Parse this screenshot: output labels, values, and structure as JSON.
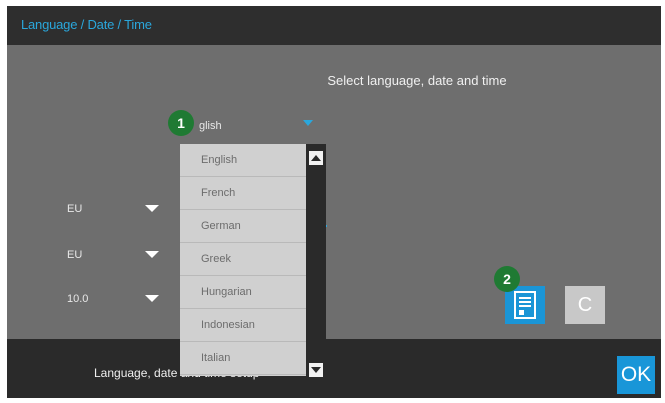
{
  "window": {
    "title": "Language / Date / Time"
  },
  "main": {
    "prompt": "Select language, date and time",
    "language_value": "glish",
    "settings": [
      {
        "value": "EU"
      },
      {
        "value": "EU"
      },
      {
        "value": "10.0"
      }
    ]
  },
  "language_dropdown": {
    "options": [
      "English",
      "French",
      "German",
      "Greek",
      "Hungarian",
      "Indonesian",
      "Italian"
    ]
  },
  "footer": {
    "status_text": "Language, date and time setup",
    "ok_label": "OK",
    "clear_label": "C"
  },
  "callouts": [
    "1",
    "2"
  ],
  "colors": {
    "accent": "#2aa7dc",
    "callout": "#1f7a33",
    "panel": "#6e6e6e",
    "bar": "#2a2a2a"
  }
}
